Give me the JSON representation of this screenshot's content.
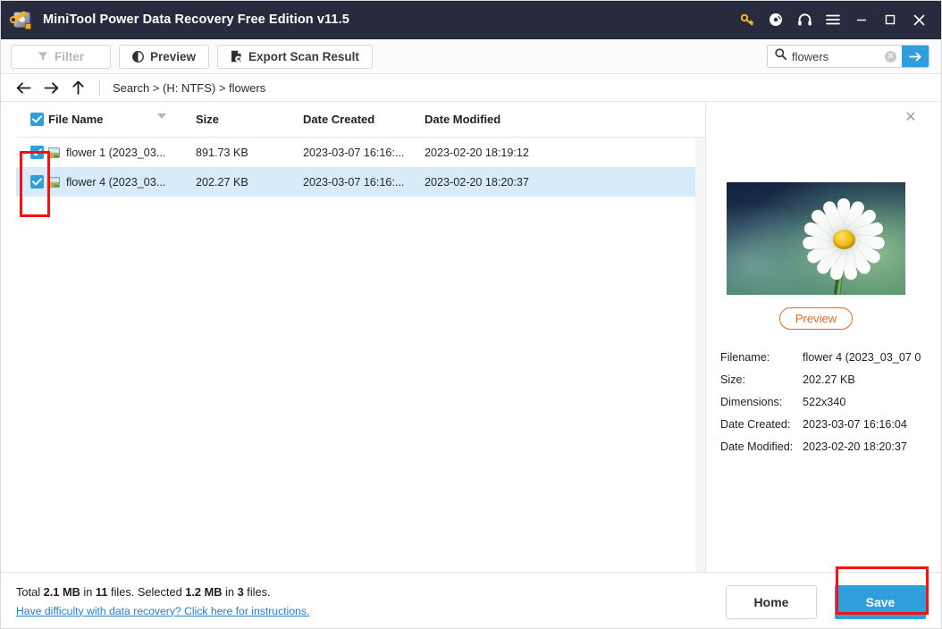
{
  "window": {
    "title": "MiniTool Power Data Recovery Free Edition v11.5",
    "app_icon": "disk-key-icon",
    "controls": [
      {
        "name": "license-key-icon",
        "glyph": "key"
      },
      {
        "name": "disc-icon",
        "glyph": "disc"
      },
      {
        "name": "headphones-icon",
        "glyph": "headphones"
      },
      {
        "name": "menu-icon",
        "glyph": "hamburger"
      },
      {
        "name": "minimize-button",
        "glyph": "minimize"
      },
      {
        "name": "maximize-button",
        "glyph": "maximize"
      },
      {
        "name": "close-button",
        "glyph": "close"
      }
    ]
  },
  "toolbar": {
    "filter_label": "Filter",
    "preview_label": "Preview",
    "export_label": "Export Scan Result",
    "filter_disabled": true
  },
  "search": {
    "value": "flowers",
    "placeholder": "Search",
    "icon": "search-icon",
    "clear_glyph": "✕",
    "go_glyph": "→"
  },
  "breadcrumb": {
    "back_icon": "arrow-left-icon",
    "forward_icon": "arrow-right-icon",
    "up_icon": "arrow-up-icon",
    "path": "Search > (H: NTFS) > flowers"
  },
  "file_list": {
    "columns": [
      "File Name",
      "Size",
      "Date Created",
      "Date Modified"
    ],
    "header_checkbox_checked": true,
    "sort_column": "File Name",
    "sort_direction": "desc",
    "rows": [
      {
        "checked": true,
        "name": "flower 1 (2023_03...",
        "size": "891.73 KB",
        "created": "2023-03-07 16:16:...",
        "modified": "2023-02-20 18:19:12",
        "selected": false
      },
      {
        "checked": true,
        "name": "flower 4 (2023_03...",
        "size": "202.27 KB",
        "created": "2023-03-07 16:16:...",
        "modified": "2023-02-20 18:20:37",
        "selected": true
      }
    ]
  },
  "preview_panel": {
    "close_glyph": "✕",
    "thumbnail_alt": "daisy-flower-thumbnail",
    "preview_button_label": "Preview",
    "details": [
      {
        "label": "Filename:",
        "value": "flower 4 (2023_03_07 0"
      },
      {
        "label": "Size:",
        "value": "202.27 KB"
      },
      {
        "label": "Dimensions:",
        "value": "522x340"
      },
      {
        "label": "Date Created:",
        "value": "2023-03-07 16:16:04"
      },
      {
        "label": "Date Modified:",
        "value": "2023-02-20 18:20:37"
      }
    ]
  },
  "footer": {
    "total_prefix": "Total ",
    "total_size": "2.1 MB",
    "total_mid": " in ",
    "total_count": "11",
    "total_suffix": " files.",
    "selected_prefix": "  Selected ",
    "selected_size": "1.2 MB",
    "selected_mid": " in ",
    "selected_count": "3",
    "selected_suffix": " files.",
    "help_link": "Have difficulty with data recovery? Click here for instructions.",
    "home_label": "Home",
    "save_label": "Save"
  },
  "colors": {
    "titlebar": "#282b3e",
    "accent_blue": "#2e9fdc",
    "selected_row": "#d7ebfa",
    "annotation_red": "#fb1111",
    "preview_orange": "#e06b1f",
    "link_blue": "#1f7fd4",
    "key_gold": "#f0b429"
  }
}
